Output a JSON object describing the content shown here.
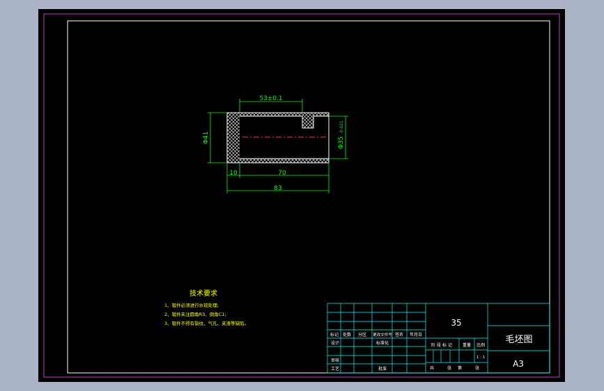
{
  "colors": {
    "background_outer": "#abb4c7",
    "paper": "#000000",
    "border_outer": "#c040c0",
    "frame_inner": "#ffffff",
    "part": "#ffffff",
    "dimension": "#00ff00",
    "centerline": "#ff3030",
    "title_block": "#00ffff",
    "title_text": "#ffffff",
    "notes_text": "#ffff00"
  },
  "drawing": {
    "dims": {
      "top_width": "53±0.1",
      "left_height": "Φ41",
      "right_diameter": "Φ35",
      "right_tolerance": "-0.021",
      "bottom_left": "10",
      "bottom_mid": "70",
      "overall_length": "83"
    }
  },
  "notes": {
    "title": "技术要求",
    "items": [
      "1、锻件必须进行水韧处理;",
      "2、锻件未注圆角R3、倒角C1;",
      "3、锻件不得有裂纹、气孔、夹渣等缺陷。"
    ]
  },
  "title_block": {
    "material": "35",
    "part_name": "毛坯图",
    "sheet_size": "A3",
    "scale_value": "1 : 1",
    "header_labels": [
      "标记",
      "处数",
      "分区",
      "更改文件号",
      "签名",
      "年月日"
    ],
    "design": "设计",
    "standardization": "标准化",
    "review": "审核",
    "process": "工艺",
    "approve": "批准",
    "stage_mark": "阶段标记",
    "weight": "重量",
    "scale_label": "比例",
    "sheets_total": "共",
    "sheets_label": "张",
    "sheet_no": "第",
    "sheet_label": "张"
  }
}
